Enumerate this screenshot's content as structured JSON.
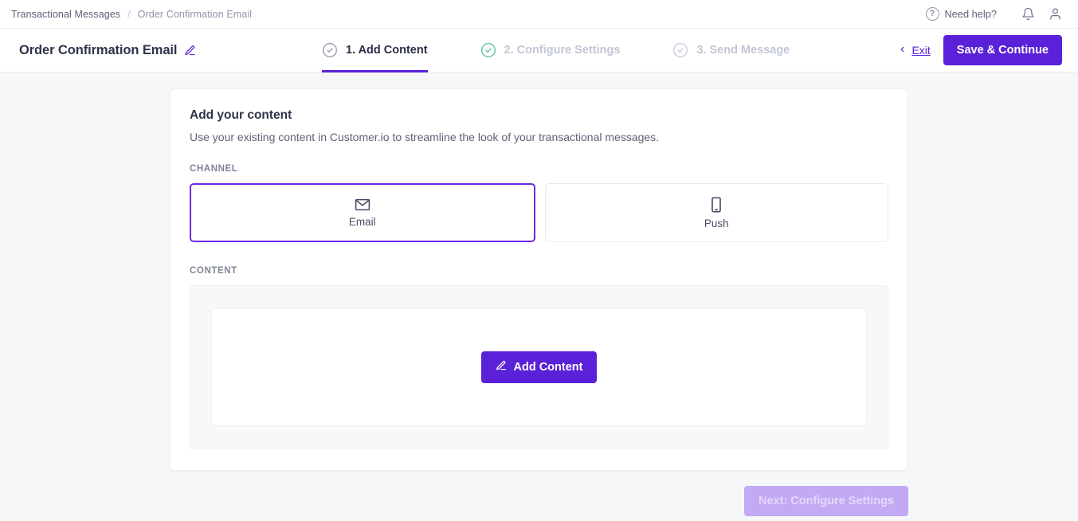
{
  "breadcrumb": {
    "parent": "Transactional Messages",
    "separator": "/",
    "current": "Order Confirmation Email"
  },
  "topbar": {
    "help_label": "Need help?",
    "help_icon": "question-mark-circle-icon",
    "notification_icon": "bell-icon",
    "account_icon": "user-icon"
  },
  "header": {
    "page_title": "Order Confirmation Email",
    "edit_icon": "pencil-icon",
    "exit_label": "Exit",
    "exit_chevron": "chevron-left-icon",
    "save_label": "Save & Continue"
  },
  "steps": [
    {
      "label": "1. Add Content",
      "state": "active",
      "check_color": "#9ea3bb"
    },
    {
      "label": "2. Configure Settings",
      "state": "inactive",
      "check_color": "#67c7a6"
    },
    {
      "label": "3. Send Message",
      "state": "inactive",
      "check_color": "#cdd0de"
    }
  ],
  "card": {
    "title": "Add your content",
    "description": "Use your existing content in Customer.io to streamline the look of your transactional messages.",
    "channel_section_label": "CHANNEL",
    "content_section_label": "CONTENT",
    "channels": [
      {
        "label": "Email",
        "icon": "envelope-icon",
        "selected": true
      },
      {
        "label": "Push",
        "icon": "mobile-phone-icon",
        "selected": false
      }
    ],
    "add_content_label": "Add Content",
    "add_content_icon": "pencil-icon"
  },
  "footer": {
    "next_label": "Next: Configure Settings",
    "next_disabled": true
  },
  "colors": {
    "accent_purple": "#5b21d8",
    "accent_purple_light": "#c3a9f3",
    "step_complete_green": "#67c7a6",
    "page_background": "#f6f7f9",
    "text_dark": "#2f3349",
    "text_muted": "#5c6179"
  }
}
